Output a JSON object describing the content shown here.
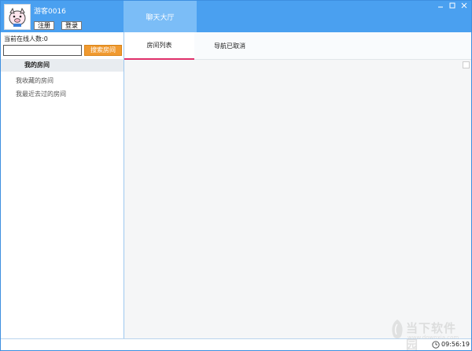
{
  "user": {
    "name": "游客0016",
    "register_label": "注册",
    "login_label": "登录"
  },
  "header": {
    "lobby_tab": "聊天大厅",
    "window_controls": [
      "minimize-icon",
      "maximize-icon",
      "close-icon"
    ]
  },
  "sidebar": {
    "online_count": "当前在线人数:0",
    "search_value": "",
    "search_button": "搜索房间",
    "my_rooms": "我的房间",
    "favorites": "我收藏的房间",
    "recent": "我最近去过的房间"
  },
  "tabs": {
    "room_list": "房间列表",
    "nav_cancelled": "导航已取消"
  },
  "status": {
    "time": "09:56:19"
  },
  "watermark": {
    "title": "当下软件园",
    "url": "www.downxia.com"
  },
  "colors": {
    "header_blue": "#4aa0f0",
    "lobby_tab": "#7bbdf7",
    "search_orange": "#f09a30",
    "active_tab_underline": "#e0306a"
  }
}
